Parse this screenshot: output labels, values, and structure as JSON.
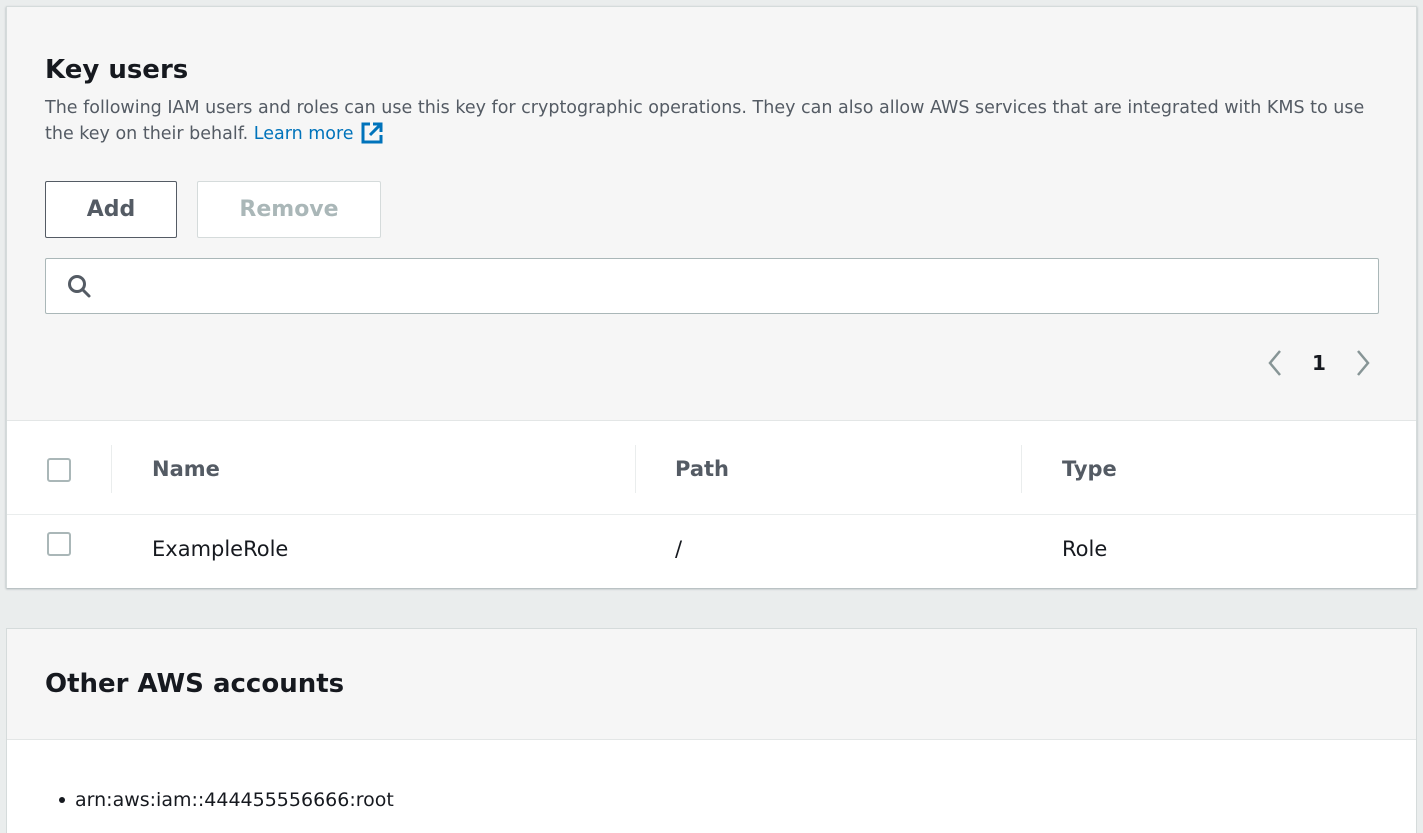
{
  "key_users": {
    "title": "Key users",
    "description": "The following IAM users and roles can use this key for cryptographic operations. They can also allow AWS services that are integrated with KMS to use the key on their behalf.",
    "learn_more": "Learn more",
    "add_label": "Add",
    "remove_label": "Remove",
    "search_value": "",
    "search_placeholder": "",
    "page": "1",
    "columns": {
      "name": "Name",
      "path": "Path",
      "type": "Type"
    },
    "rows": [
      {
        "name": "ExampleRole",
        "path": "/",
        "type": "Role"
      }
    ]
  },
  "other_accounts": {
    "title": "Other AWS accounts",
    "items": [
      "arn:aws:iam::444455556666:root"
    ]
  },
  "colors": {
    "link": "#0073bb",
    "header_bg": "#f6f6f6",
    "text": "#16191f",
    "muted": "#545b64",
    "disabled": "#aab7b8"
  },
  "icons": {
    "external_link": "external-link-icon",
    "search": "search-icon",
    "prev": "chevron-left-icon",
    "next": "chevron-right-icon"
  }
}
